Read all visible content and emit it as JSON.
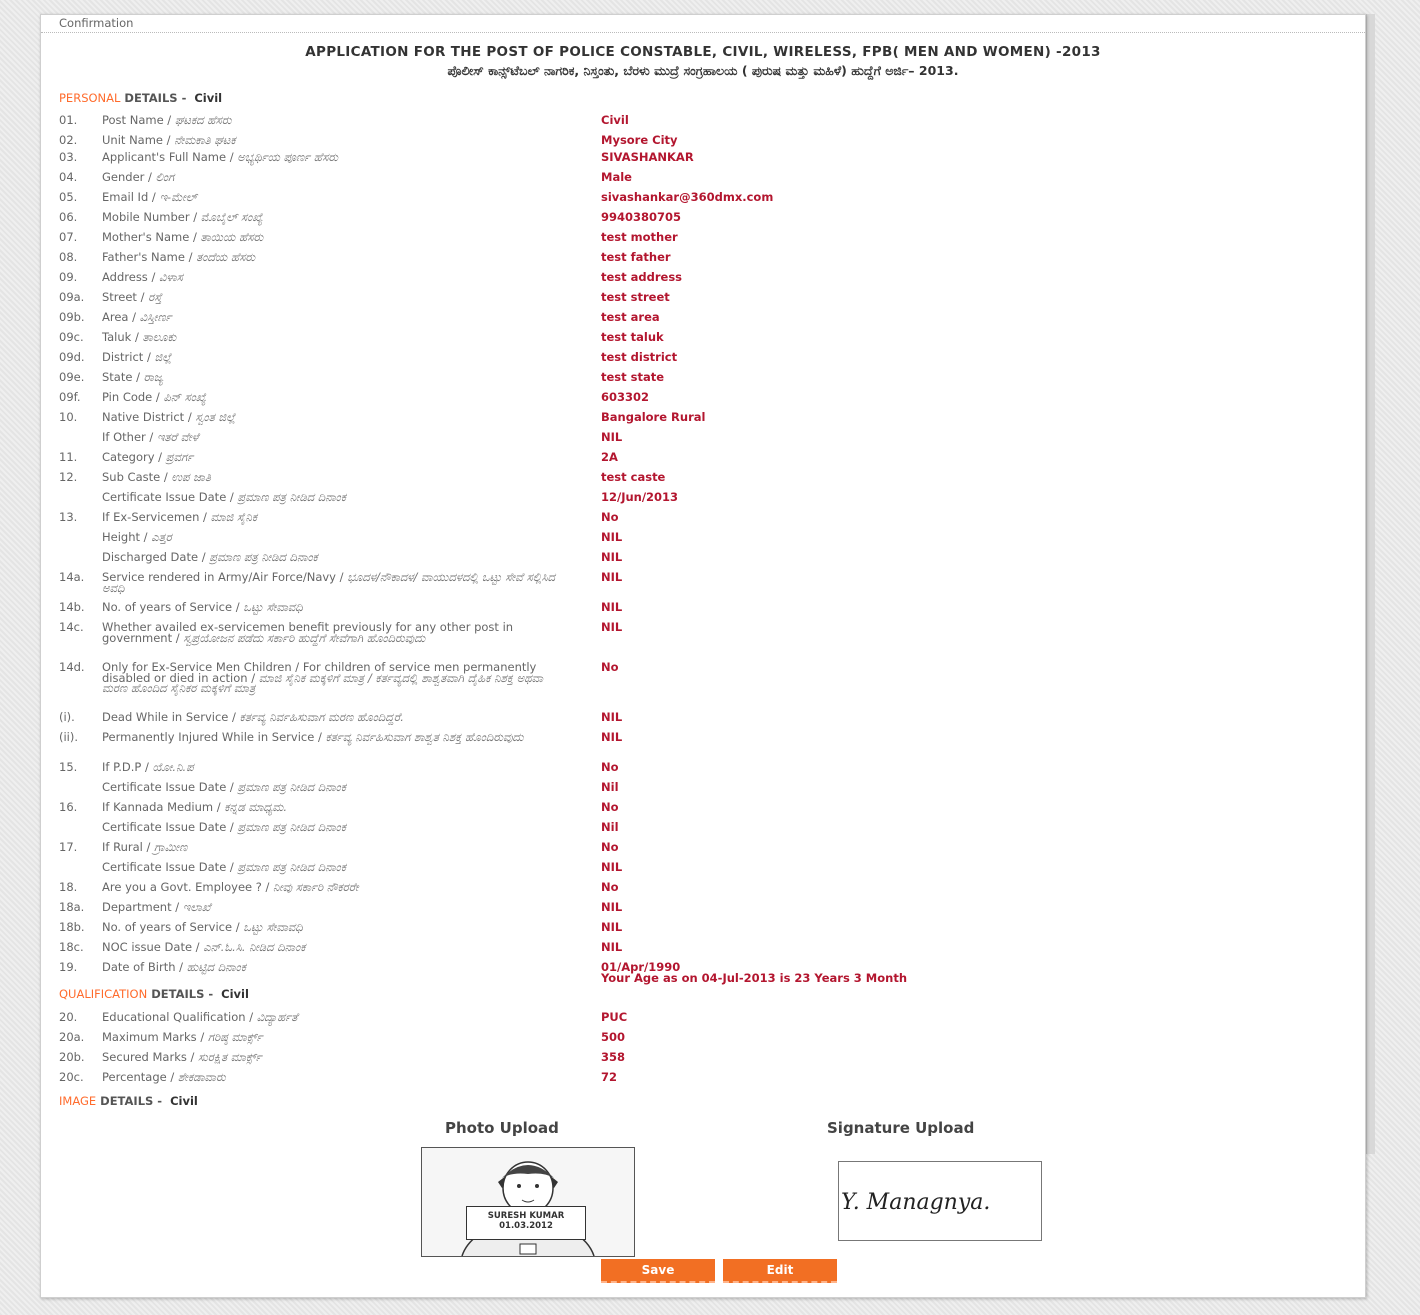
{
  "window": {
    "header": "Confirmation"
  },
  "titles": {
    "en": "APPLICATION FOR THE POST OF POLICE CONSTABLE, CIVIL, WIRELESS, FPB( MEN AND WOMEN) -2013",
    "kn": "ಪೊಲೀಸ್ ಕಾನ್ಸ್‌ಟೆಬಲ್ ನಾಗರಿಕ, ನಿಸ್ತಂತು, ಬೆರಳು ಮುದ್ರೆ ಸಂಗ್ರಹಾಲಯ ( ಪುರುಷ ಮತ್ತು ಮಹಿಳೆ) ಹುದ್ದೆಗೆ ಅರ್ಜಿ– 2013."
  },
  "sections": {
    "personal": {
      "highlight": "PERSONAL",
      "rest": " DETAILS -",
      "category": "Civil"
    },
    "qualification": {
      "highlight": "QUALIFICATION",
      "rest": " DETAILS -",
      "category": "Civil"
    },
    "image": {
      "highlight": "IMAGE",
      "rest": " DETAILS -",
      "category": "Civil"
    }
  },
  "personal": [
    {
      "num": "01.",
      "label": "Post Name / ",
      "kn": "ಘಟಕದ ಹೆಸರು",
      "value": "Civil"
    },
    {
      "num": "02.",
      "label": "Unit Name / ",
      "kn": "ನೇಮಕಾತಿ ಘಟಕ",
      "value": "Mysore City"
    },
    {
      "num": "03.",
      "label": "Applicant's Full Name / ",
      "kn": "ಅಭ್ಯರ್ಥಿಯ ಪೂರ್ಣ ಹೆಸರು",
      "value": "SIVASHANKAR"
    },
    {
      "num": "04.",
      "label": "Gender / ",
      "kn": "ಲಿಂಗ",
      "value": "Male"
    },
    {
      "num": "05.",
      "label": "Email Id / ",
      "kn": "ಇ-ಮೇಲ್",
      "value": "sivashankar@360dmx.com"
    },
    {
      "num": "06.",
      "label": "Mobile Number / ",
      "kn": "ಮೊಬೈಲ್ ಸಂಖ್ಯೆ",
      "value": "9940380705"
    },
    {
      "num": "07.",
      "label": "Mother's Name / ",
      "kn": "ತಾಯಿಯ ಹೆಸರು",
      "value": "test mother"
    },
    {
      "num": "08.",
      "label": "Father's Name / ",
      "kn": "ತಂದೆಯ ಹೆಸರು",
      "value": "test father"
    },
    {
      "num": "09.",
      "label": "Address / ",
      "kn": "ವಿಳಾಸ",
      "value": "test address"
    },
    {
      "num": "09a.",
      "label": "Street / ",
      "kn": "ರಸ್ತೆ",
      "value": "test street"
    },
    {
      "num": "09b.",
      "label": "Area / ",
      "kn": "ವಿಸ್ತೀರ್ಣ",
      "value": "test area"
    },
    {
      "num": "09c.",
      "label": "Taluk / ",
      "kn": "ತಾಲೂಕು",
      "value": "test taluk"
    },
    {
      "num": "09d.",
      "label": "District / ",
      "kn": "ಜಿಲ್ಲೆ",
      "value": "test district"
    },
    {
      "num": "09e.",
      "label": "State / ",
      "kn": "ರಾಜ್ಯ",
      "value": "test state"
    },
    {
      "num": "09f.",
      "label": "Pin Code / ",
      "kn": "ಪಿನ್ ಸಂಖ್ಯೆ",
      "value": "603302"
    },
    {
      "num": "10.",
      "label": "Native District / ",
      "kn": "ಸ್ವಂತ ಜಿಲ್ಲೆ",
      "value": "Bangalore Rural"
    },
    {
      "num": "",
      "label": "If Other / ",
      "kn": "ಇತರೆ ವೇಳೆ",
      "value": "NIL"
    },
    {
      "num": "11.",
      "label": "Category / ",
      "kn": "ಪ್ರವರ್ಗ",
      "value": "2A"
    },
    {
      "num": "12.",
      "label": "Sub Caste / ",
      "kn": "ಉಪ ಜಾತಿ",
      "value": "test caste"
    },
    {
      "num": "",
      "label": "Certificate Issue Date / ",
      "kn": "ಪ್ರಮಾಣ ಪತ್ರ ನೀಡಿದ ದಿನಾಂಕ",
      "value": "12/Jun/2013"
    },
    {
      "num": "13.",
      "label": "If Ex-Servicemen / ",
      "kn": "ಮಾಜಿ ಸೈನಿಕ",
      "value": "No"
    },
    {
      "num": "",
      "label": "Height / ",
      "kn": "ಎತ್ತರ",
      "value": "NIL"
    },
    {
      "num": "",
      "label": "Discharged Date / ",
      "kn": "ಪ್ರಮಾಣ ಪತ್ರ ನೀಡಿದ ದಿನಾಂಕ",
      "value": "NIL"
    },
    {
      "num": "14a.",
      "label": "Service rendered in Army/Air Force/Navy / ",
      "kn": "ಭೂದಳ/ನೌಕಾದಳ/ ವಾಯುದಳದಲ್ಲಿ ಒಟ್ಟು ಸೇವೆ ಸಲ್ಲಿಸಿದ ಅವಧಿ",
      "value": "NIL"
    },
    {
      "num": "14b.",
      "label": "No. of years of Service / ",
      "kn": "ಒಟ್ಟು ಸೇವಾವಧಿ",
      "value": "NIL"
    },
    {
      "num": "14c.",
      "label": "Whether availed ex-servicemen benefit previously for any other post in government / ",
      "kn": "ಸ್ವಪ್ರಯೋಜನ ಪಡೆದು ಸರ್ಕಾರಿ ಹುದ್ದೆಗೆ ಸೇವೆಗಾಗಿ ಹೊಂದಿರುವುದು",
      "value": "NIL"
    },
    {
      "num": "14d.",
      "label": "Only for Ex-Service Men Children / For children of service men permanently disabled or died in action / ",
      "kn": "ಮಾಜಿ ಸೈನಿಕ ಮಕ್ಕಳಿಗೆ ಮಾತ್ರ / ಕರ್ತವ್ಯದಲ್ಲಿ ಶಾಶ್ವತವಾಗಿ ದೈಹಿಕ ನಿಶಕ್ತ ಅಥವಾ ಮರಣ ಹೊಂದಿದ ಸೈನಿಕರ ಮಕ್ಕಳಿಗೆ ಮಾತ್ರ",
      "value": "No"
    },
    {
      "num": "(i).",
      "label": "Dead While in Service / ",
      "kn": "ಕರ್ತವ್ಯ ನಿರ್ವಹಿಸುವಾಗ ಮರಣ ಹೊಂದಿದ್ದರೆ.",
      "value": "NIL"
    },
    {
      "num": "(ii).",
      "label": "Permanently Injured While in Service / ",
      "kn": "ಕರ್ತವ್ಯ ನಿರ್ವಹಿಸುವಾಗ ಶಾಶ್ವತ ನಿಶಕ್ತ ಹೊಂದಿರುವುದು",
      "value": "NIL"
    },
    {
      "num": "15.",
      "label": "If P.D.P / ",
      "kn": "ಯೋ.ನಿ.ಪ",
      "value": "No"
    },
    {
      "num": "",
      "label": "Certificate Issue Date / ",
      "kn": "ಪ್ರಮಾಣ ಪತ್ರ ನೀಡಿದ ದಿನಾಂಕ",
      "value": "Nil"
    },
    {
      "num": "16.",
      "label": "If Kannada Medium / ",
      "kn": "ಕನ್ನಡ ಮಾಧ್ಯಮ.",
      "value": "No"
    },
    {
      "num": "",
      "label": "Certificate Issue Date / ",
      "kn": "ಪ್ರಮಾಣ ಪತ್ರ ನೀಡಿದ ದಿನಾಂಕ",
      "value": "Nil"
    },
    {
      "num": "17.",
      "label": "If Rural / ",
      "kn": "ಗ್ರಾಮೀಣ",
      "value": "No"
    },
    {
      "num": "",
      "label": "Certificate Issue Date / ",
      "kn": "ಪ್ರಮಾಣ ಪತ್ರ ನೀಡಿದ ದಿನಾಂಕ",
      "value": "NIL"
    },
    {
      "num": "18.",
      "label": "Are you a Govt. Employee ? / ",
      "kn": "ನೀವು ಸರ್ಕಾರಿ ನೌಕರರೇ",
      "value": "No"
    },
    {
      "num": "18a.",
      "label": "Department / ",
      "kn": "ಇಲಾಖೆ",
      "value": "NIL"
    },
    {
      "num": "18b.",
      "label": "No. of years of Service / ",
      "kn": "ಒಟ್ಟು ಸೇವಾವಧಿ",
      "value": "NIL"
    },
    {
      "num": "18c.",
      "label": "NOC issue Date / ",
      "kn": "ಎನ್.ಓ.ಸಿ. ನೀಡಿದ ದಿನಾಂಕ",
      "value": "NIL"
    },
    {
      "num": "19.",
      "label": "Date of Birth / ",
      "kn": "ಹುಟ್ಟಿದ ದಿನಾಂಕ",
      "value": "01/Apr/1990",
      "value2": "Your Age as on 04-Jul-2013 is 23 Years 3 Month"
    }
  ],
  "qualification": [
    {
      "num": "20.",
      "label": "Educational Qualification / ",
      "kn": "ವಿದ್ಯಾರ್ಹತೆ",
      "value": "PUC"
    },
    {
      "num": "20a.",
      "label": "Maximum Marks / ",
      "kn": "ಗರಿಷ್ಠ ಮಾರ್ಕ್ಸ್",
      "value": "500"
    },
    {
      "num": "20b.",
      "label": "Secured Marks / ",
      "kn": "ಸುರಕ್ಷಿತ ಮಾರ್ಕ್ಸ್",
      "value": "358"
    },
    {
      "num": "20c.",
      "label": "Percentage / ",
      "kn": "ಶೇಕಡಾವಾರು",
      "value": "72"
    }
  ],
  "uploads": {
    "photo_title": "Photo Upload",
    "signature_title": "Signature Upload",
    "nameplate_name": "SURESH KUMAR",
    "nameplate_date": "01.03.2012",
    "signature_text": "Y. Managnya."
  },
  "buttons": {
    "save": "Save",
    "edit": "Edit"
  }
}
